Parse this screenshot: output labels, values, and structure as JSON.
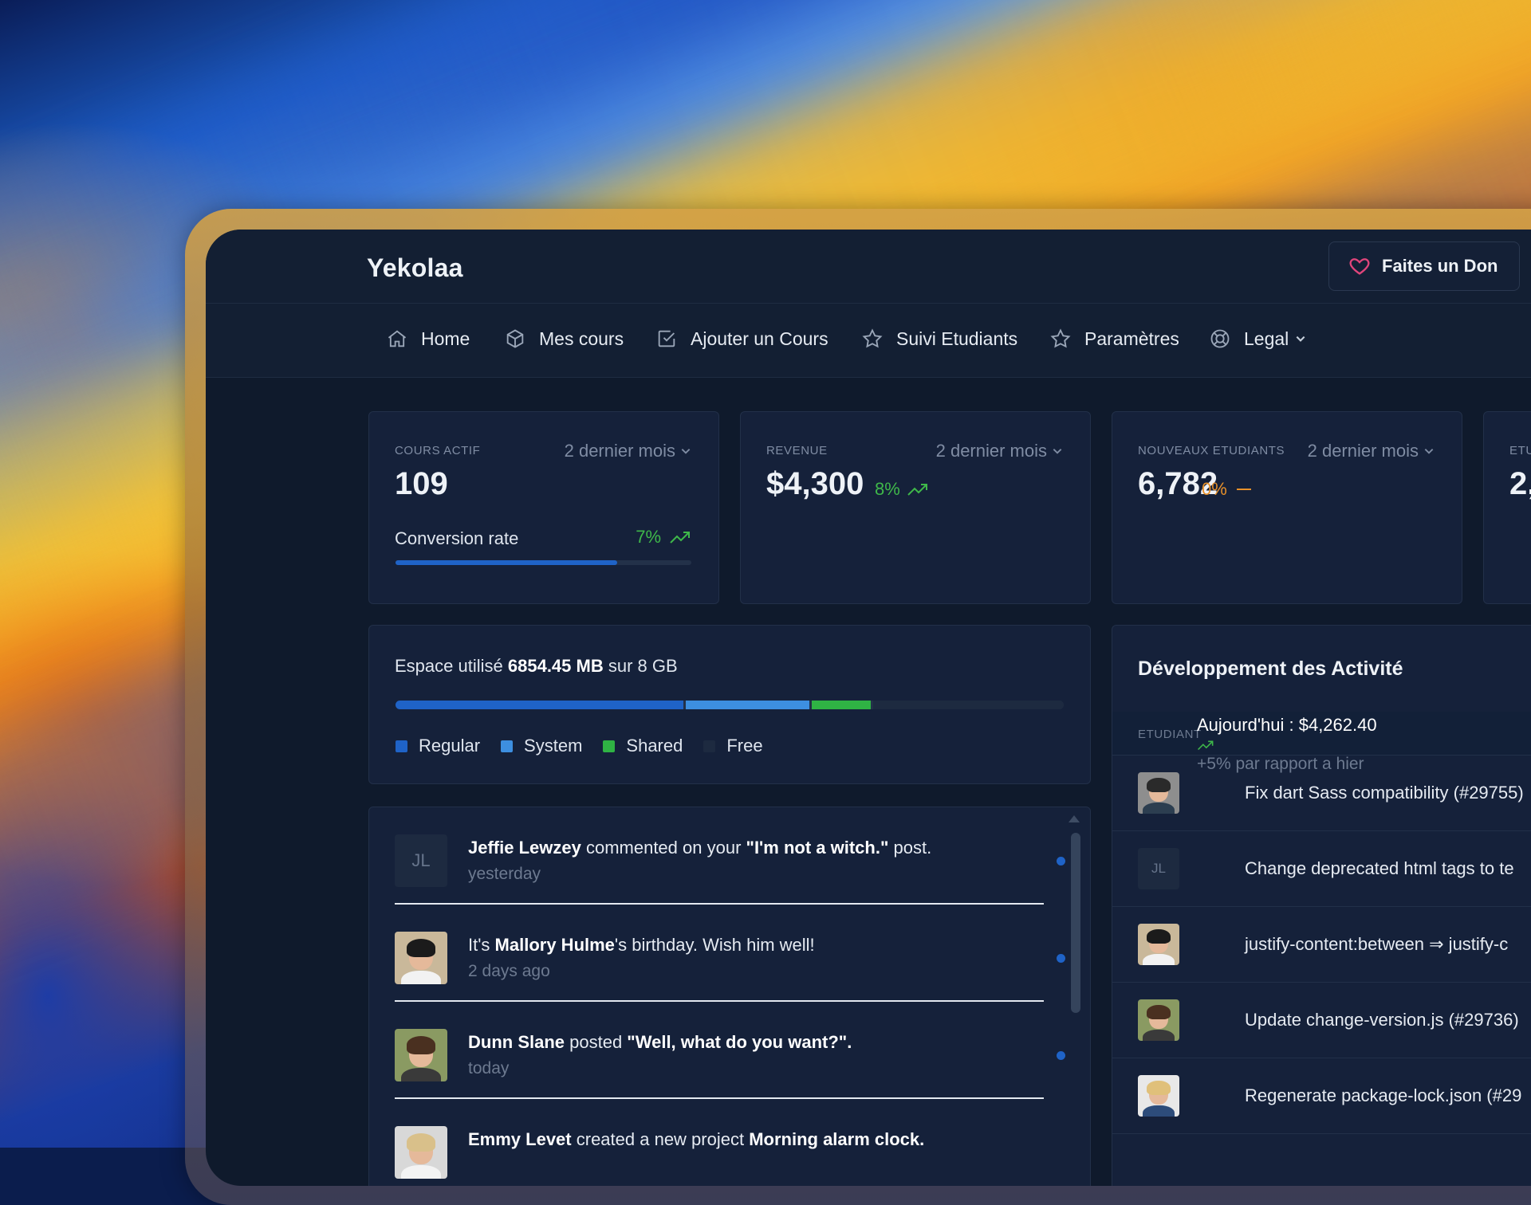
{
  "app": {
    "brand": "Yekolaa",
    "donate_label": "Faites un Don"
  },
  "nav": [
    {
      "label": "Home",
      "icon": "home-icon"
    },
    {
      "label": "Mes cours",
      "icon": "box-icon"
    },
    {
      "label": "Ajouter un Cours",
      "icon": "checkbox-icon"
    },
    {
      "label": "Suivi Etudiants",
      "icon": "star-icon"
    },
    {
      "label": "Paramètres",
      "icon": "star-icon"
    },
    {
      "label": "Legal",
      "icon": "lifebuoy-icon",
      "has_dropdown": true
    }
  ],
  "stats": [
    {
      "label": "COURS ACTIF",
      "period": "2 dernier mois",
      "value": "109",
      "conversion": {
        "label": "Conversion rate",
        "percent": "7%",
        "fill": 0.75
      }
    },
    {
      "label": "REVENUE",
      "period": "2 dernier mois",
      "value": "$4,300",
      "change": "8%",
      "trend": "up"
    },
    {
      "label": "NOUVEAUX ETUDIANTS",
      "period": "2 dernier mois",
      "value": "6,782",
      "change": "0%",
      "trend": "flat"
    },
    {
      "label": "ETU",
      "value": "2,"
    }
  ],
  "storage": {
    "prefix": "Espace utilisé",
    "used": "6854.45 MB",
    "suffix": "sur 8 GB",
    "segments": [
      {
        "label": "Regular",
        "fraction": 0.435,
        "color": "#1f63c7"
      },
      {
        "label": "System",
        "fraction": 0.187,
        "color": "#3d8fe0"
      },
      {
        "label": "Shared",
        "fraction": 0.09,
        "color": "#2fb344"
      },
      {
        "label": "Free",
        "fraction": 0.288,
        "color": "#1d2a40"
      }
    ]
  },
  "notifications": [
    {
      "avatar_initials": "JL",
      "name": "Jeffie Lewzey",
      "text": " commented on your ",
      "quote": "\"I'm not a witch.\"",
      "after": " post.",
      "time": "yesterday"
    },
    {
      "avatar": "photo",
      "before": "It's ",
      "name": "Mallory Hulme",
      "text": "'s birthday. Wish him well!",
      "time": "2 days ago"
    },
    {
      "avatar": "photo",
      "name": "Dunn Slane",
      "text": " posted ",
      "quote": "\"Well, what do you want?\".",
      "time": "today"
    },
    {
      "avatar": "photo",
      "name": "Emmy Levet",
      "text": " created a new project ",
      "quote": "Morning alarm clock."
    }
  ],
  "activity": {
    "title": "Développement des Activité",
    "column_header": "ETUDIANT",
    "tooltip": {
      "title": "Aujourd'hui : $4,262.40",
      "subtitle": "+5% par rapport a hier"
    },
    "rows": [
      {
        "avatar": "photo",
        "text": "Fix dart Sass compatibility (#29755)"
      },
      {
        "avatar_initials": "JL",
        "text": "Change deprecated html tags to te"
      },
      {
        "avatar": "photo",
        "text": "justify-content:between ⇒ justify-c"
      },
      {
        "avatar": "photo",
        "text": "Update change-version.js (#29736)"
      },
      {
        "avatar": "photo",
        "text": "Regenerate package-lock.json (#29"
      }
    ]
  }
}
